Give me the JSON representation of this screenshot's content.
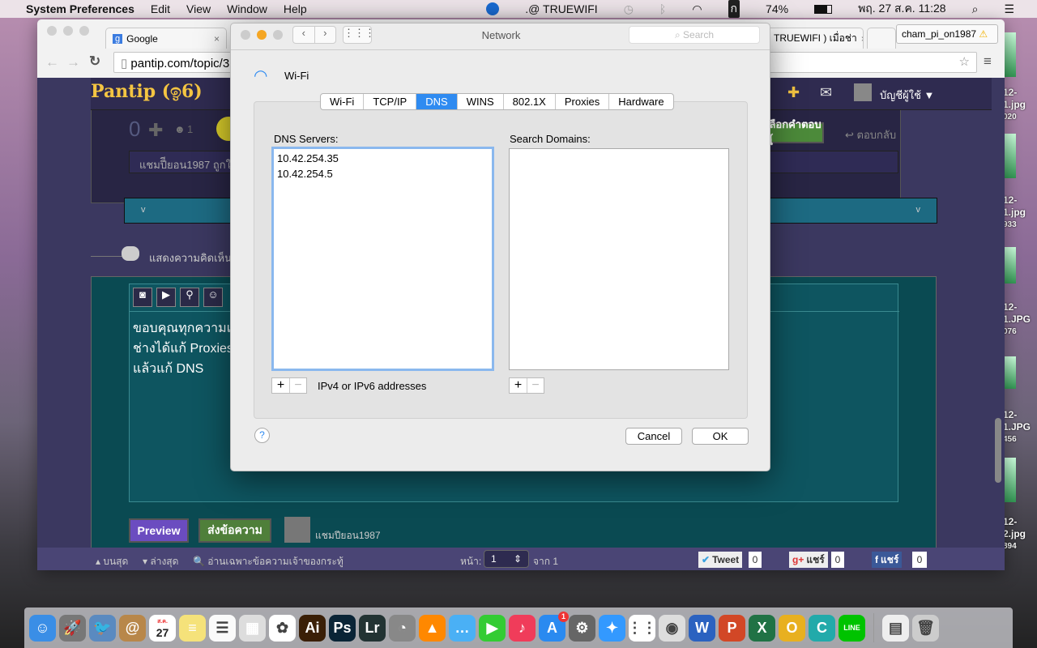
{
  "menubar": {
    "app": "System Preferences",
    "items": [
      "Edit",
      "View",
      "Window",
      "Help"
    ],
    "wifi_name": ".@ TRUEWIFI",
    "input_source": "ก",
    "battery": "74%",
    "datetime": "พฤ. 27 ส.ค.  11:28"
  },
  "browser": {
    "tabs": [
      "Google",
      "TRUEWIFI ) เมื่อช่า"
    ],
    "profile": "cham_pi_on1987",
    "url": "pantip.com/topic/3"
  },
  "site": {
    "logo": "Pantip",
    "vote_count": "0",
    "emo_count": "1",
    "comment_preview": "แชมปีียอน1987 ถูกใจ",
    "choose_answer": "เลือกคำตอบนี้",
    "reply": "ตอบกลับ",
    "chevron": "v",
    "comment_heading": "แสดงความคิดเห็น",
    "account": "บัญชีผู้ใช้ ▼",
    "editor_lines": [
      "ขอบคุณทุกความเห็",
      "ช่างได้แก้ Proxies",
      "แล้วแก้ DNS"
    ],
    "preview_label": "Preview",
    "send_label": "ส่งข้อความ",
    "username": "แชมปียอน1987",
    "footer": {
      "top": "บนสุด",
      "bottom": "ล่างสุด",
      "owner_only": "อ่านเฉพาะข้อความเจ้าของกระทู้",
      "page_label": "หน้า:",
      "page_value": "1",
      "page_of": "จาก 1",
      "tweet": "Tweet",
      "tweet_count": "0",
      "gplus": "แชร์",
      "gplus_count": "0",
      "fb": "แชร์",
      "fb_count": "0"
    }
  },
  "dialog": {
    "title": "Network",
    "search_placeholder": "Search",
    "interface": "Wi-Fi",
    "tabs": [
      "Wi-Fi",
      "TCP/IP",
      "DNS",
      "WINS",
      "802.1X",
      "Proxies",
      "Hardware"
    ],
    "selected_tab": "DNS",
    "dns_label": "DNS Servers:",
    "dns_servers": [
      "10.42.254.35",
      "10.42.254.5"
    ],
    "dns_hint": "IPv4 or IPv6 addresses",
    "search_domains_label": "Search Domains:",
    "cancel": "Cancel",
    "ok": "OK",
    "help": "?"
  },
  "desktop_files": [
    [
      "12-",
      "1.jpg",
      "020"
    ],
    [
      "12-",
      "1.jpg",
      "933"
    ],
    [
      "12-",
      "1.JPG",
      "076"
    ],
    [
      "12-",
      "1.JPG",
      "456"
    ],
    [
      "12-",
      "2.jpg",
      "894"
    ]
  ],
  "dock": {
    "calendar_day": "27",
    "calendar_month": "ส.ค.",
    "appstore_badge": "1",
    "apps": [
      {
        "n": "finder",
        "c": "#3a8ee6",
        "t": "☺"
      },
      {
        "n": "launchpad",
        "c": "#777",
        "t": "🚀"
      },
      {
        "n": "preview",
        "c": "#5a8ac0",
        "t": "🐦"
      },
      {
        "n": "contacts",
        "c": "#b8874a",
        "t": "@"
      },
      {
        "n": "calendar",
        "c": "#fff",
        "t": ""
      },
      {
        "n": "notes",
        "c": "#f5e27a",
        "t": "≡"
      },
      {
        "n": "reminders",
        "c": "#fafafa",
        "t": "☰"
      },
      {
        "n": "photo-viewer",
        "c": "#ddd",
        "t": "▦"
      },
      {
        "n": "photos",
        "c": "#fff",
        "t": "✿"
      },
      {
        "n": "illustrator",
        "c": "#3a1f07",
        "t": "Ai"
      },
      {
        "n": "photoshop",
        "c": "#0a2436",
        "t": "Ps"
      },
      {
        "n": "lightroom",
        "c": "#233",
        "t": "Lr"
      },
      {
        "n": "disk-utility",
        "c": "#888",
        "t": "◔"
      },
      {
        "n": "vlc",
        "c": "#f80",
        "t": "▲"
      },
      {
        "n": "messages",
        "c": "#4ab0f5",
        "t": "…"
      },
      {
        "n": "facetime",
        "c": "#3c3",
        "t": "▶"
      },
      {
        "n": "itunes",
        "c": "#f03c5a",
        "t": "♪"
      },
      {
        "n": "app-store",
        "c": "#2a8af0",
        "t": "A"
      },
      {
        "n": "system-preferences",
        "c": "#666",
        "t": "⚙"
      },
      {
        "n": "safari",
        "c": "#39f",
        "t": "✦"
      },
      {
        "n": "grid-app",
        "c": "#fff",
        "t": "⋮⋮"
      },
      {
        "n": "chrome",
        "c": "#ddd",
        "t": "◉"
      },
      {
        "n": "word",
        "c": "#2b62c0",
        "t": "W"
      },
      {
        "n": "powerpoint",
        "c": "#d24726",
        "t": "P"
      },
      {
        "n": "excel",
        "c": "#207245",
        "t": "X"
      },
      {
        "n": "outlook",
        "c": "#e8b020",
        "t": "O"
      },
      {
        "n": "c-app",
        "c": "#2aa",
        "t": "C"
      },
      {
        "n": "line",
        "c": "#00c300",
        "t": "LINE"
      },
      {
        "n": "downloads",
        "c": "#eee",
        "t": "▤"
      },
      {
        "n": "trash",
        "c": "#ccc",
        "t": "🗑"
      }
    ]
  }
}
